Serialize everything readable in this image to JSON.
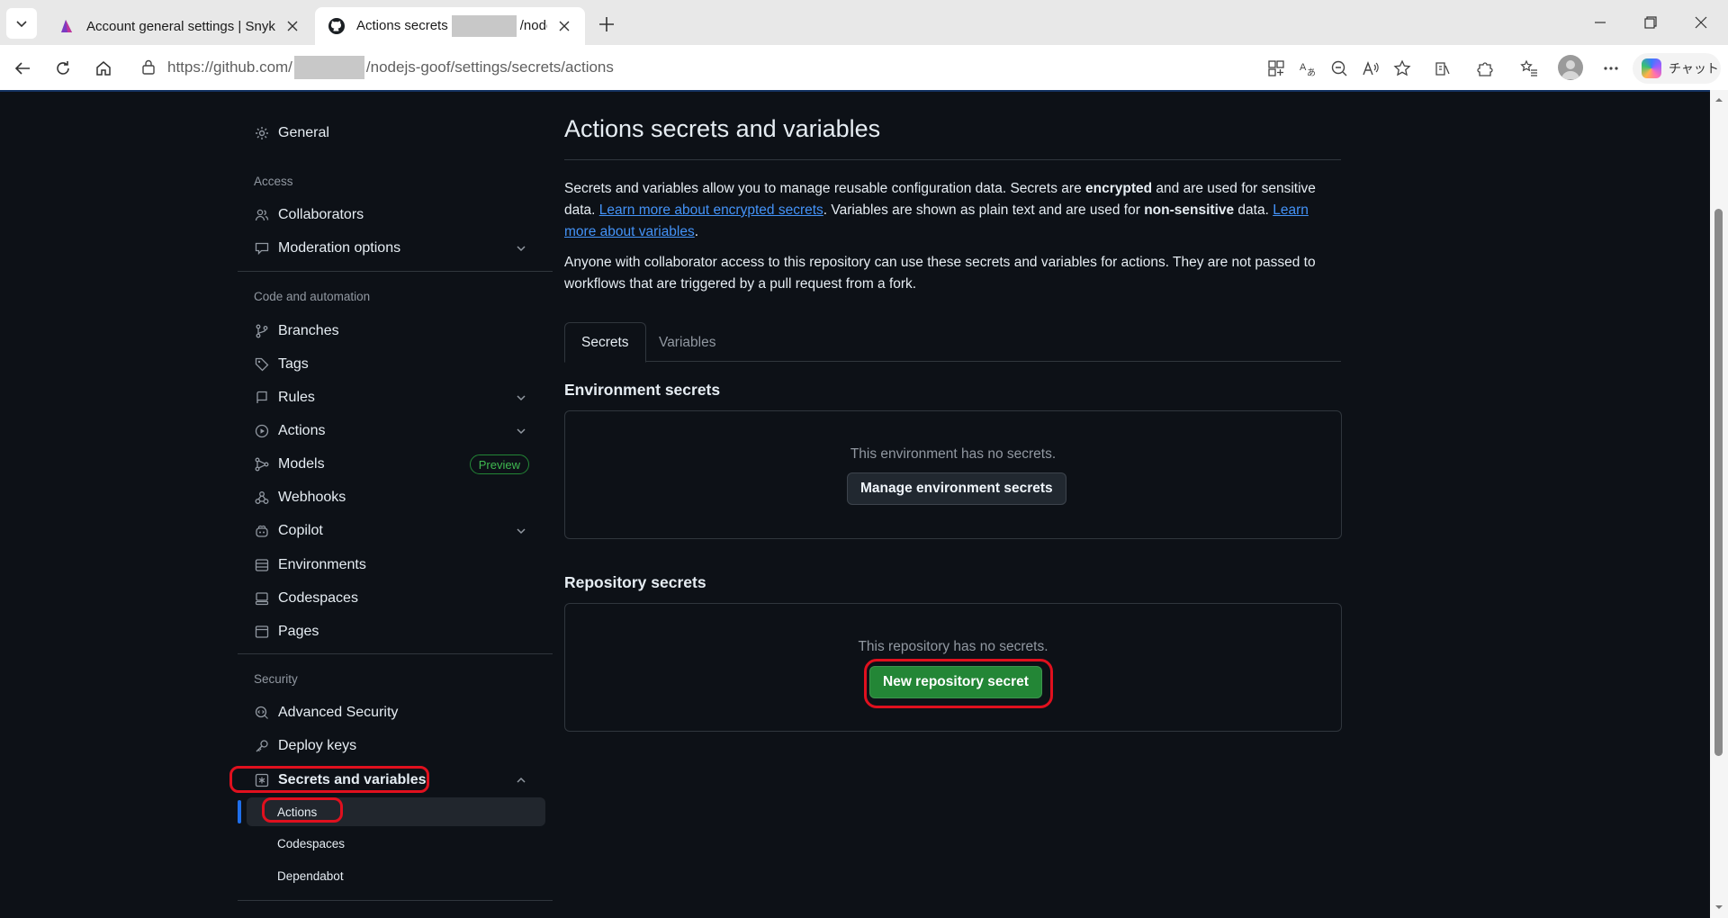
{
  "browser": {
    "tabs": [
      {
        "title": "Account general settings | Snyk",
        "active": false
      },
      {
        "title_prefix": "Actions secrets",
        "title_suffix": "/nodejs",
        "active": true
      }
    ],
    "url_prefix": "https://github.com/",
    "url_suffix": "/nodejs-goof/settings/secrets/actions",
    "copilot_label": "チャット"
  },
  "sidebar": {
    "general": "General",
    "access_heading": "Access",
    "collaborators": "Collaborators",
    "moderation": "Moderation options",
    "code_heading": "Code and automation",
    "branches": "Branches",
    "tags": "Tags",
    "rules": "Rules",
    "actions": "Actions",
    "models": "Models",
    "models_badge": "Preview",
    "webhooks": "Webhooks",
    "copilot": "Copilot",
    "environments": "Environments",
    "codespaces": "Codespaces",
    "pages": "Pages",
    "security_heading": "Security",
    "advanced_security": "Advanced Security",
    "deploy_keys": "Deploy keys",
    "secrets_and_variables": "Secrets and variables",
    "sub_actions": "Actions",
    "sub_codespaces": "Codespaces",
    "sub_dependabot": "Dependabot"
  },
  "main": {
    "title": "Actions secrets and variables",
    "para1_a": "Secrets and variables allow you to manage reusable configuration data. Secrets are ",
    "para1_b": "encrypted",
    "para1_c": " and are used for sensitive data. ",
    "para1_link1": "Learn more about encrypted secrets",
    "para1_d": ". Variables are shown as plain text and are used for ",
    "para1_e": "non-sensitive",
    "para1_f": " data. ",
    "para1_link2": "Learn more about variables",
    "para1_g": ".",
    "para2": "Anyone with collaborator access to this repository can use these secrets and variables for actions. They are not passed to workflows that are triggered by a pull request from a fork.",
    "tab_secrets": "Secrets",
    "tab_variables": "Variables",
    "env_title": "Environment secrets",
    "env_empty": "This environment has no secrets.",
    "env_button": "Manage environment secrets",
    "repo_title": "Repository secrets",
    "repo_empty": "This repository has no secrets.",
    "repo_button": "New repository secret"
  },
  "colors": {
    "page_bg": "#0d1117",
    "accent_blue": "#4493f8",
    "primary_green": "#238636",
    "annotation_red": "#e0101e"
  }
}
